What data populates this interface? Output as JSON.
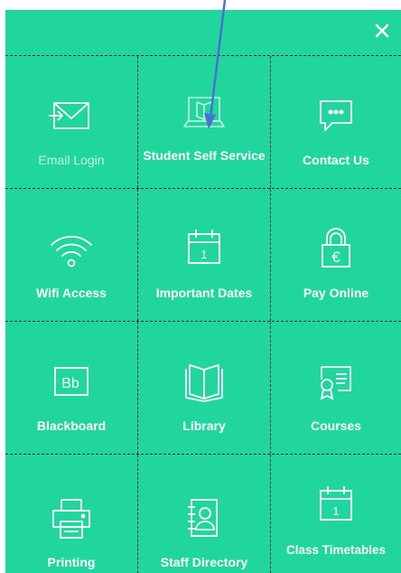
{
  "colors": {
    "panel": "#21d69c",
    "icon_stroke": "#ffffff",
    "label": "#ffffff",
    "label_muted": "#c6f2e0",
    "arrow": "#4a6fd4"
  },
  "close": {
    "icon": "close-icon"
  },
  "tiles": [
    {
      "label": "Email Login",
      "icon": "envelope-icon"
    },
    {
      "label": "Student Self Service",
      "icon": "laptop-book-icon"
    },
    {
      "label": "Contact Us",
      "icon": "speech-bubble-icon"
    },
    {
      "label": "Wifi Access",
      "icon": "wifi-icon"
    },
    {
      "label": "Important Dates",
      "icon": "calendar-icon"
    },
    {
      "label": "Pay Online",
      "icon": "padlock-euro-icon"
    },
    {
      "label": "Blackboard",
      "icon": "blackboard-icon"
    },
    {
      "label": "Library",
      "icon": "book-icon"
    },
    {
      "label": "Courses",
      "icon": "certificate-icon"
    },
    {
      "label": "Printing",
      "icon": "printer-icon"
    },
    {
      "label": "Staff Directory",
      "icon": "address-book-icon"
    },
    {
      "label": "Class Timetables",
      "icon": "calendar-icon"
    }
  ],
  "icon_texts": {
    "blackboard": "Bb",
    "calendar_day": "1",
    "currency": "€"
  }
}
